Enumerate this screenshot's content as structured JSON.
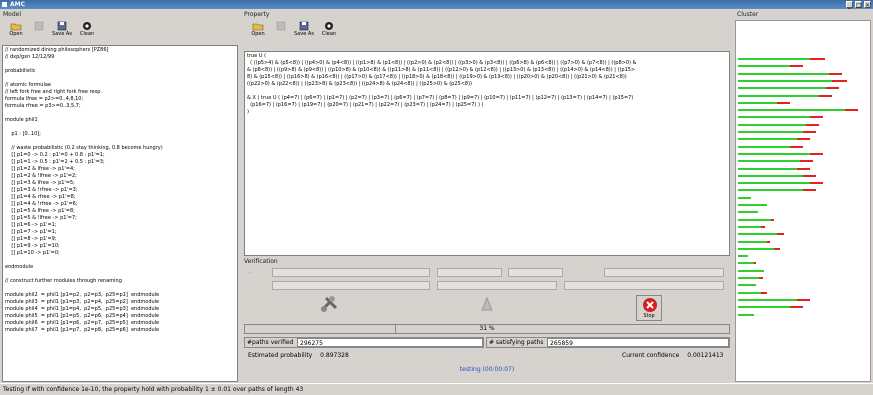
{
  "window": {
    "title": "AMC",
    "buttons": [
      "_",
      "□",
      "×"
    ]
  },
  "model": {
    "label": "Model",
    "toolbar": [
      {
        "label": "Open"
      },
      {
        "label": ""
      },
      {
        "label": "Save As"
      },
      {
        "label": "Clean"
      }
    ],
    "code_lines": [
      "// randomized dining philosophers [PZ86]",
      "// dxp/gxn 12/12/99",
      "",
      "probabilistic",
      "",
      "// atomic formulae",
      "// left fork free and right fork free resp.",
      "formula lfree = p2>=0..4,8,10;",
      "formula rfree = p3>=0..3,5,7;",
      "",
      "module phil1",
      "",
      "    p1 : [0..10];",
      "",
      "    // waste probabilistic (0.2 stay thinking, 0.8 become hungry)",
      "    [] p1=0 -> 0.2 : p1'=0 + 0.8 : p1'=1;",
      "    [] p1=1 -> 0.5 : p1'=2 + 0.5 : p1'=3;",
      "    [] p1=2 & lfree -> p1'=4;",
      "    [] p1=2 & !lfree -> p1'=2;",
      "    [] p1=3 & lfree -> p1'=5;",
      "    [] p1=3 & !rfree -> p1'=3;",
      "    [] p1=4 & rfree -> p1'=8;",
      "    [] p1=4 & !rfree -> p1'=6;",
      "    [] p1=5 & lfree -> p1'=8;",
      "    [] p1=5 & !lfree -> p1'=7;",
      "    [] p1=6 -> p1'=1;",
      "    [] p1=7 -> p1'=1;",
      "    [] p1=8 -> p1'=9;",
      "    [] p1=9 -> p1'=10;",
      "    [] p1=10 -> p1'=0;",
      "",
      "endmodule",
      "",
      "// construct further modules through renaming",
      "",
      "module phil2  = phil1 [p1=p2,  p2=p3,  p25=p1]  endmodule",
      "module phil3  = phil1 [p1=p3,  p2=p4,  p25=p2]  endmodule",
      "module phil4  = phil1 [p1=p4,  p2=p5,  p25=p3]  endmodule",
      "module phil5  = phil1 [p1=p5,  p2=p6,  p25=p4]  endmodule",
      "module phil6  = phil1 [p1=p6,  p2=p7,  p25=p5]  endmodule",
      "module phil7  = phil1 [p1=p7,  p2=p8,  p25=p6]  endmodule"
    ]
  },
  "property": {
    "label": "Property",
    "toolbar": [
      {
        "label": "Open"
      },
      {
        "label": ""
      },
      {
        "label": "Save As"
      },
      {
        "label": "Clean"
      }
    ],
    "text_lines": [
      "true U (",
      "  ( ((p5>4) & (p5<8)) | ((p4>0) & (p4<8)) | ((p1>8) & (p1<8)) | ((p2>0) & (p2<8)) | ((p3>0) & (p3<8)) | ((p6>8) & (p6<8)) | ((p7>0) & (p7<8)) | ((p8>0) &",
      "& (p8<8)) | ((p9>8) & (p9<8)) | ((p10>8) & (p10<8)) & ((p11>8) & (p11<8)) | ((p12>0) & (p12<8)) | ((p13>0) & (p13<8)) | ((p14>0) & (p14<8)) | ((p15>",
      "8) & (p15<8)) | ((p16>8) & (p16<8)) | ((p17>0) & (p17<8)) | ((p18>0) & (p18<8)) | ((p19>0) & (p19<8)) | ((p20>0) & (p20<8)) | ((p21>0) & (p21<8))",
      "((p22>0) & (p22<8)) | ((p23>8) & (p23<8)) | ((p24>8) & (p24<8)) | ((p25>0) & (p25<8))",
      "",
      "& X ( true U ( (p4=7) | (p6=7) | (p1=7) | (p2=7) | (p3=7) | (p6=7) | (p7=7) | (p8=7) | (p9=7) | (p10=7) | (p11=7) | (p12=7) | (p13=7) | (p14=7) | (p15=7)",
      "  (p16=7) | (p16=7) | (p19=7) | (p20=7) | (p21=7) | (p22=7) | (p23=7) | (p24=7) | (p25=7) ) )",
      ")"
    ]
  },
  "verification": {
    "label": "Verification",
    "progress_label": "31 %",
    "progress_value": 0.31,
    "paths_verified_label": "#paths verified",
    "paths_verified": "296275",
    "satisfying_label": "# satisfying paths",
    "satisfying": "265859",
    "estimated_label": "Estimated probability",
    "estimated": "0.897328",
    "confidence_label": "Current confidence",
    "confidence": "0.00121413",
    "status": "testing (00:00:07)",
    "stop_label": "Stop"
  },
  "cluster": {
    "label": "Cluster",
    "bars": [
      {
        "green": 0.55,
        "red": 0.12
      },
      {
        "green": 0.4,
        "red": 0.1
      },
      {
        "green": 0.7,
        "red": 0.1
      },
      {
        "green": 0.72,
        "red": 0.12
      },
      {
        "green": 0.68,
        "red": 0.1
      },
      {
        "green": 0.62,
        "red": 0.1
      },
      {
        "green": 0.3,
        "red": 0.1
      },
      {
        "green": 0.82,
        "red": 0.1
      },
      {
        "green": 0.55,
        "red": 0.1
      },
      {
        "green": 0.52,
        "red": 0.1
      },
      {
        "green": 0.5,
        "red": 0.1
      },
      {
        "green": 0.45,
        "red": 0.1
      },
      {
        "green": 0.4,
        "red": 0.1
      },
      {
        "green": 0.55,
        "red": 0.1
      },
      {
        "green": 0.48,
        "red": 0.1
      },
      {
        "green": 0.45,
        "red": 0.1
      },
      {
        "green": 0.5,
        "red": 0.1
      },
      {
        "green": 0.55,
        "red": 0.1
      },
      {
        "green": 0.5,
        "red": 0.1
      },
      {
        "green": 0.1,
        "red": 0.0
      },
      {
        "green": 0.22,
        "red": 0.0
      },
      {
        "green": 0.15,
        "red": 0.0
      },
      {
        "green": 0.25,
        "red": 0.03
      },
      {
        "green": 0.18,
        "red": 0.03
      },
      {
        "green": 0.3,
        "red": 0.05
      },
      {
        "green": 0.22,
        "red": 0.03
      },
      {
        "green": 0.28,
        "red": 0.04
      },
      {
        "green": 0.08,
        "red": 0.0
      },
      {
        "green": 0.12,
        "red": 0.02
      },
      {
        "green": 0.2,
        "red": 0.0
      },
      {
        "green": 0.16,
        "red": 0.03
      },
      {
        "green": 0.14,
        "red": 0.0
      },
      {
        "green": 0.18,
        "red": 0.04
      },
      {
        "green": 0.45,
        "red": 0.1
      },
      {
        "green": 0.4,
        "red": 0.1
      },
      {
        "green": 0.12,
        "red": 0.0
      }
    ]
  },
  "status_bar": "Testing if with confidence 1e-10, the property hold with probability 1 ± 0.01 over paths of length 43"
}
